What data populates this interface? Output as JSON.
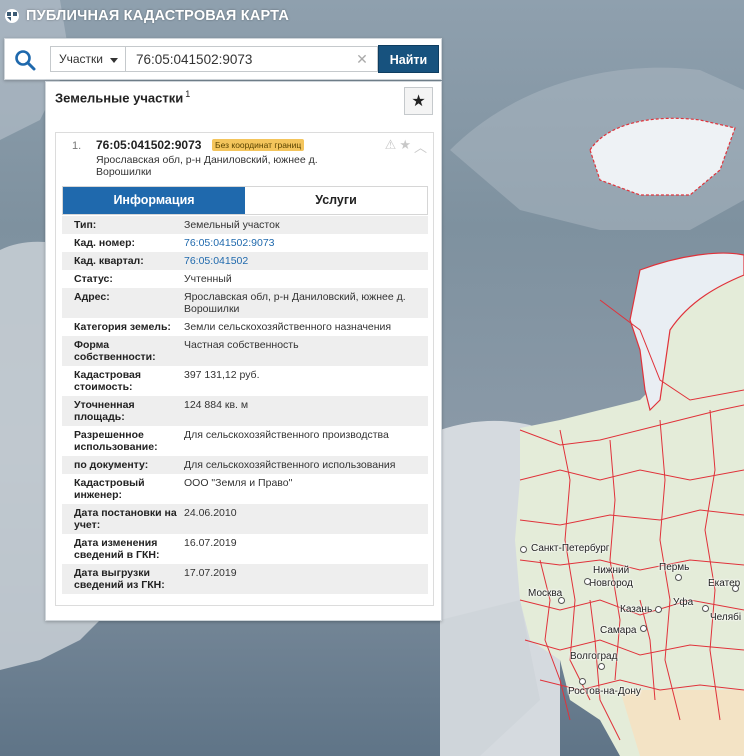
{
  "app": {
    "title": "ПУБЛИЧНАЯ КАДАСТРОВАЯ КАРТА",
    "logo_icon": "cadastre-logo-icon"
  },
  "search": {
    "type_selected": "Участки",
    "query": "76:05:041502:9073",
    "find_label": "Найти",
    "search_icon": "search-icon",
    "clear_icon": "close-icon"
  },
  "panel": {
    "title": "Земельные участки",
    "count": "1",
    "favorite_icon": "star-icon"
  },
  "result": {
    "index": "1.",
    "cad_number": "76:05:041502:9073",
    "badge": "Без координат границ",
    "address": "Ярославская обл, р-н Даниловский, южнее д. Ворошилки",
    "icons": [
      "warning-icon",
      "star-icon",
      "chevron-up-icon"
    ]
  },
  "tabs": [
    {
      "label": "Информация",
      "active": true
    },
    {
      "label": "Услуги",
      "active": false
    }
  ],
  "info_rows": [
    {
      "key": "Тип:",
      "value": "Земельный участок"
    },
    {
      "key": "Кад. номер:",
      "value": "76:05:041502:9073",
      "link": true
    },
    {
      "key": "Кад. квартал:",
      "value": "76:05:041502",
      "link": true
    },
    {
      "key": "Статус:",
      "value": "Учтенный"
    },
    {
      "key": "Адрес:",
      "value": "Ярославская обл, р-н Даниловский, южнее д. Ворошилки"
    },
    {
      "key": "Категория земель:",
      "value": "Земли сельскохозяйственного назначения"
    },
    {
      "key": "Форма собственности:",
      "value": "Частная собственность"
    },
    {
      "key": "Кадастровая стоимость:",
      "value": "397 131,12 руб."
    },
    {
      "key": "Уточненная площадь:",
      "value": "124 884 кв. м"
    },
    {
      "key": "Разрешенное использование:",
      "value": "Для сельскохозяйственного производства"
    },
    {
      "key": "по документу:",
      "value": "Для сельскохозяйственного использования"
    },
    {
      "key": "Кадастровый инженер:",
      "value": "ООО \"Земля и Право\""
    },
    {
      "key": "Дата постановки на учет:",
      "value": "24.06.2010"
    },
    {
      "key": "Дата изменения сведений в ГКН:",
      "value": "16.07.2019"
    },
    {
      "key": "Дата выгрузки сведений из ГКН:",
      "value": "17.07.2019"
    }
  ],
  "map": {
    "cities": [
      "Санкт-Петербург",
      "Нижний",
      "Новгород",
      "Пермь",
      "Екатер",
      "Москва",
      "Казань",
      "Уфа",
      "Челябі",
      "Самара",
      "Волгоград",
      "Ростов-на-Дону"
    ],
    "colors": {
      "sea": "#7e919f",
      "land": "#d9dee2",
      "russia": "#e8efe0",
      "border": "#e0323a"
    }
  }
}
